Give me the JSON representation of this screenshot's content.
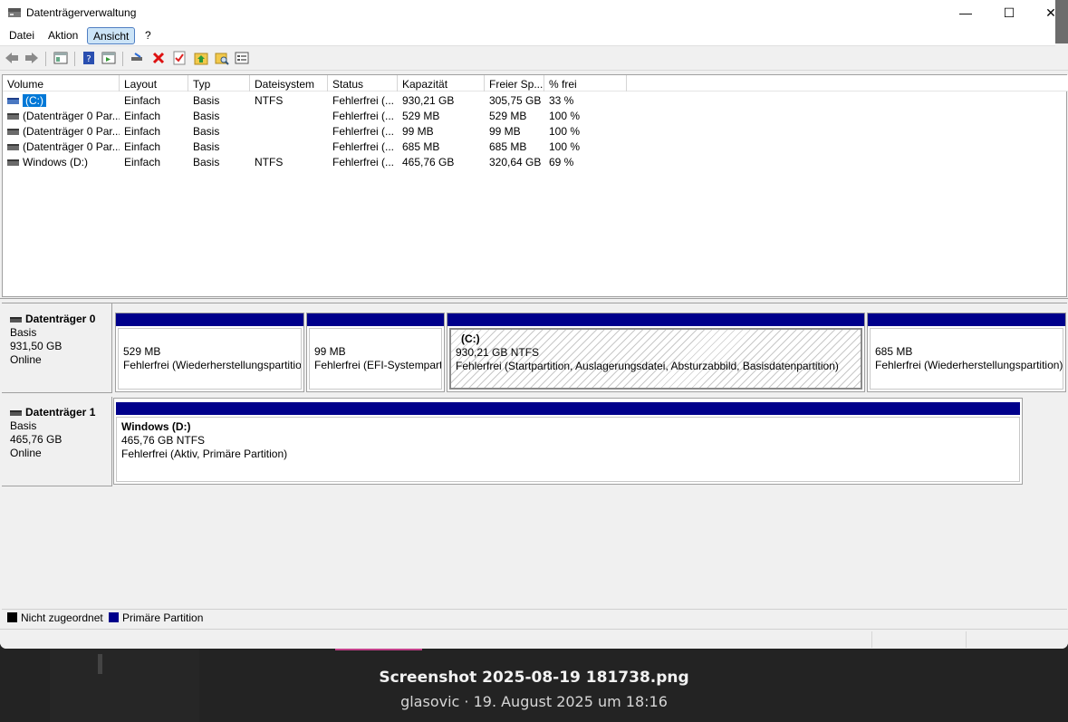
{
  "window": {
    "title": "Datenträgerverwaltung",
    "controls": {
      "minimize": "—",
      "maximize": "☐",
      "close": "✕"
    }
  },
  "menu": {
    "items": [
      {
        "label": "Datei"
      },
      {
        "label": "Aktion"
      },
      {
        "label": "Ansicht",
        "active": true
      },
      {
        "label": "?"
      }
    ]
  },
  "toolbar": {
    "icons": [
      "back-arrow-icon",
      "forward-arrow-icon",
      "list-view-icon",
      "help-icon",
      "properties-icon",
      "connect-icon",
      "delete-icon",
      "check-icon",
      "folder-up-icon",
      "search-folder-icon",
      "details-icon"
    ]
  },
  "volume_list": {
    "columns": [
      "Volume",
      "Layout",
      "Typ",
      "Dateisystem",
      "Status",
      "Kapazität",
      "Freier Sp...",
      "% frei"
    ],
    "rows": [
      {
        "volume": "(C:)",
        "layout": "Einfach",
        "typ": "Basis",
        "fs": "NTFS",
        "status": "Fehlerfrei (...",
        "cap": "930,21 GB",
        "free": "305,75 GB",
        "pct": "33 %",
        "selected": true
      },
      {
        "volume": "(Datenträger 0 Par...",
        "layout": "Einfach",
        "typ": "Basis",
        "fs": "",
        "status": "Fehlerfrei (...",
        "cap": "529 MB",
        "free": "529 MB",
        "pct": "100 %"
      },
      {
        "volume": "(Datenträger 0 Par...",
        "layout": "Einfach",
        "typ": "Basis",
        "fs": "",
        "status": "Fehlerfrei (...",
        "cap": "99 MB",
        "free": "99 MB",
        "pct": "100 %"
      },
      {
        "volume": "(Datenträger 0 Par...",
        "layout": "Einfach",
        "typ": "Basis",
        "fs": "",
        "status": "Fehlerfrei (...",
        "cap": "685 MB",
        "free": "685 MB",
        "pct": "100 %"
      },
      {
        "volume": "Windows (D:)",
        "layout": "Einfach",
        "typ": "Basis",
        "fs": "NTFS",
        "status": "Fehlerfrei (...",
        "cap": "465,76 GB",
        "free": "320,64 GB",
        "pct": "69 %"
      }
    ]
  },
  "disks": [
    {
      "name": "Datenträger 0",
      "type": "Basis",
      "size": "931,50 GB",
      "state": "Online",
      "partitions": [
        {
          "title": "",
          "size": "529 MB",
          "status": "Fehlerfrei (Wiederherstellungspartitio"
        },
        {
          "title": "",
          "size": "99 MB",
          "status": "Fehlerfrei (EFI-Systempartit"
        },
        {
          "title": "(C:)",
          "size": "930,21 GB NTFS",
          "status": "Fehlerfrei (Startpartition, Auslagerungsdatei, Absturzabbild, Basisdatenpartition)"
        },
        {
          "title": "",
          "size": "685 MB",
          "status": "Fehlerfrei (Wiederherstellungspartition)"
        }
      ]
    },
    {
      "name": "Datenträger 1",
      "type": "Basis",
      "size": "465,76 GB",
      "state": "Online",
      "partitions": [
        {
          "title": "Windows  (D:)",
          "size": "465,76 GB NTFS",
          "status": "Fehlerfrei (Aktiv, Primäre Partition)"
        }
      ]
    }
  ],
  "legend": {
    "unallocated": "Nicht zugeordnet",
    "primary": "Primäre Partition",
    "colors": {
      "unallocated": "#000000",
      "primary": "#00008b"
    }
  },
  "viewer": {
    "filename": "Screenshot 2025-08-19 181738.png",
    "meta": "glasovic · 19. August 2025 um 18:16"
  }
}
